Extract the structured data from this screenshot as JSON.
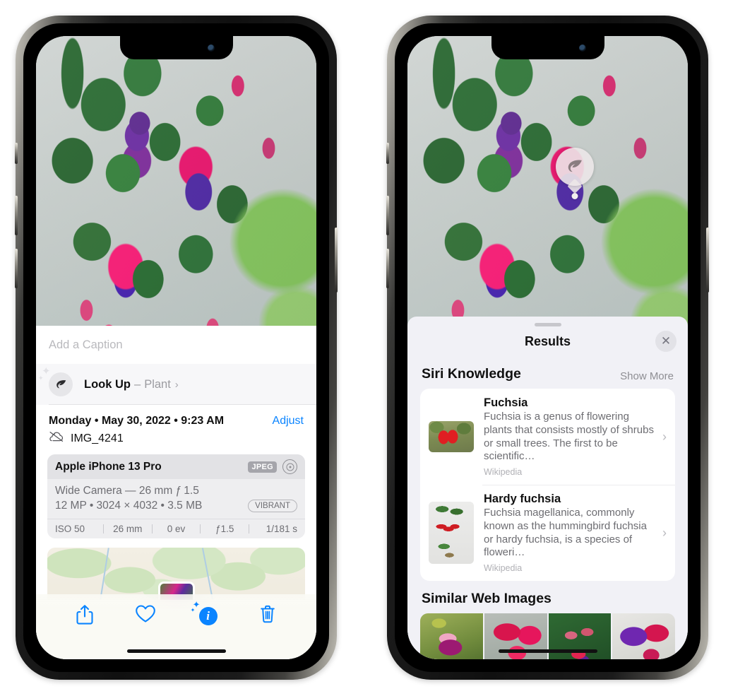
{
  "left_phone": {
    "name": "photo-detail-screen",
    "caption": {
      "placeholder": "Add a Caption",
      "value": ""
    },
    "look_up": {
      "icon": "leaf-icon",
      "label": "Look Up",
      "separator": "–",
      "kind": "Plant",
      "chevron": "›"
    },
    "meta": {
      "date_line": "Monday • May 30, 2022 • 9:23 AM",
      "adjust_label": "Adjust",
      "cloud_icon": "icloud-slash-icon",
      "file_name": "IMG_4241"
    },
    "exif": {
      "device": "Apple iPhone 13 Pro",
      "format_tag": "JPEG",
      "raw_icon": "aperture-icon",
      "lens": "Wide Camera — 26 mm ƒ 1.5",
      "size_line": "12 MP • 3024 × 4032 • 3.5 MB",
      "style_badge": "VIBRANT",
      "stats": [
        "ISO 50",
        "26 mm",
        "0 ev",
        "ƒ1.5",
        "1/181 s"
      ]
    },
    "map": {
      "name": "location-map",
      "pin": "photo-thumbnail-pin"
    },
    "toolbar": [
      {
        "name": "share-button",
        "icon": "share-icon"
      },
      {
        "name": "favorite-button",
        "icon": "heart-icon"
      },
      {
        "name": "info-button",
        "icon": "sparkle-info-icon",
        "glyph": "i"
      },
      {
        "name": "delete-button",
        "icon": "trash-icon"
      }
    ],
    "accent_color": "#0A84FF"
  },
  "right_phone": {
    "name": "visual-lookup-results-screen",
    "pin": {
      "icon": "leaf-icon",
      "label": "visual-lookup-pin"
    },
    "sheet": {
      "grabber": "drag-handle",
      "title": "Results",
      "close_icon": "close-icon"
    },
    "siri_knowledge": {
      "section_title": "Siri Knowledge",
      "show_more": "Show More",
      "items": [
        {
          "title": "Fuchsia",
          "description": "Fuchsia is a genus of flowering plants that consists mostly of shrubs or small trees. The first to be scientific…",
          "source": "Wikipedia",
          "chevron": "›"
        },
        {
          "title": "Hardy fuchsia",
          "description": "Fuchsia magellanica, commonly known as the hummingbird fuchsia or hardy fuchsia, is a species of floweri…",
          "source": "Wikipedia",
          "chevron": "›"
        }
      ]
    },
    "similar_web_images": {
      "section_title": "Similar Web Images",
      "count": 4
    },
    "sheet_bg": "#F1F1F6"
  }
}
